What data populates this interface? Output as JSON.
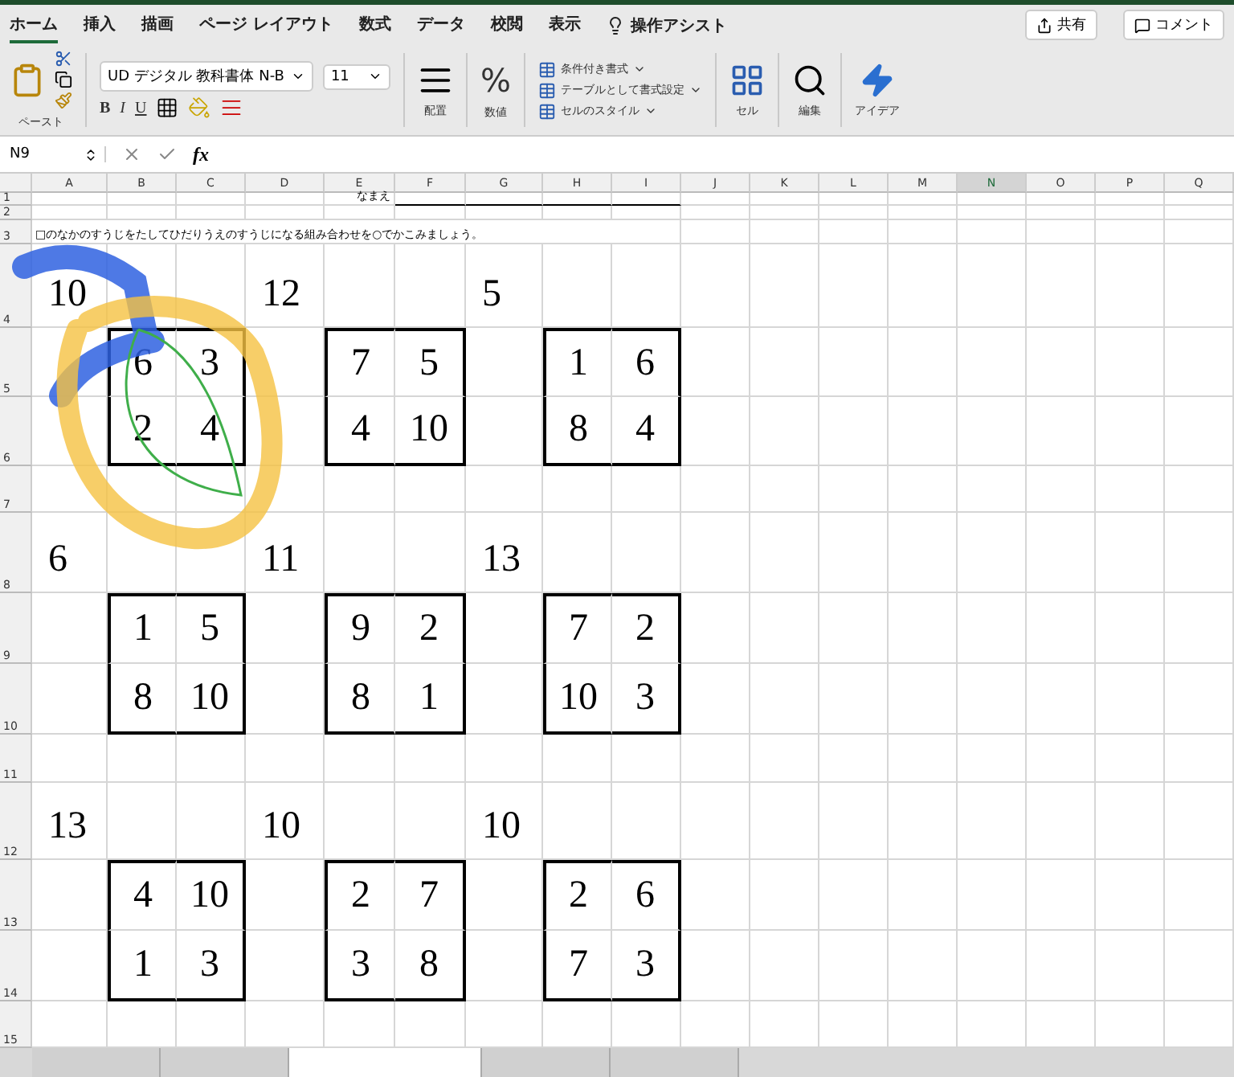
{
  "menu_tabs": [
    {
      "label": "ホーム",
      "selected": true
    },
    {
      "label": "挿入",
      "selected": false
    },
    {
      "label": "描画",
      "selected": false
    },
    {
      "label": "ページ レイアウト",
      "selected": false
    },
    {
      "label": "数式",
      "selected": false
    },
    {
      "label": "データ",
      "selected": false
    },
    {
      "label": "校閲",
      "selected": false
    },
    {
      "label": "表示",
      "selected": false
    }
  ],
  "tell_me": "操作アシスト",
  "share_button": "共有",
  "comment_button": "コメント",
  "ribbon": {
    "paste": "ペースト",
    "font_name": "UD デジタル 教科書体 N-B",
    "font_size": "11",
    "bold": "B",
    "italic": "I",
    "underline": "U",
    "alignment": "配置",
    "percent": "%",
    "number": "数値",
    "styles": [
      "条件付き書式",
      "テーブルとして書式設定",
      "セルのスタイル"
    ],
    "cells": "セル",
    "editing": "編集",
    "ideas": "アイデア"
  },
  "formula_bar": {
    "name_box": "N9",
    "fx": "fx"
  },
  "columns": [
    {
      "label": "A",
      "selected": false
    },
    {
      "label": "B",
      "selected": false
    },
    {
      "label": "C",
      "selected": false
    },
    {
      "label": "D",
      "selected": false
    },
    {
      "label": "E",
      "selected": false
    },
    {
      "label": "F",
      "selected": false
    },
    {
      "label": "G",
      "selected": false
    },
    {
      "label": "H",
      "selected": false
    },
    {
      "label": "I",
      "selected": false
    },
    {
      "label": "J",
      "selected": false
    },
    {
      "label": "K",
      "selected": false
    },
    {
      "label": "L",
      "selected": false
    },
    {
      "label": "M",
      "selected": false
    },
    {
      "label": "N",
      "selected": true
    },
    {
      "label": "O",
      "selected": false
    },
    {
      "label": "P",
      "selected": false
    },
    {
      "label": "Q",
      "selected": false
    }
  ],
  "rows": [
    "1",
    "2",
    "3",
    "4",
    "5",
    "6",
    "7",
    "8",
    "9",
    "10",
    "11",
    "12",
    "13",
    "14",
    "15"
  ],
  "sheet": {
    "name_label": "なまえ",
    "instruction": "□のなかのすうじをたしてひだりうえのすうじになる組み合わせを○でかこみましょう。",
    "problems": [
      [
        {
          "target": "10",
          "numbers": [
            [
              "6",
              "3"
            ],
            [
              "2",
              "4"
            ]
          ]
        },
        {
          "target": "12",
          "numbers": [
            [
              "7",
              "5"
            ],
            [
              "4",
              "10"
            ]
          ]
        },
        {
          "target": "5",
          "numbers": [
            [
              "1",
              "6"
            ],
            [
              "8",
              "4"
            ]
          ]
        }
      ],
      [
        {
          "target": "6",
          "numbers": [
            [
              "1",
              "5"
            ],
            [
              "8",
              "10"
            ]
          ]
        },
        {
          "target": "11",
          "numbers": [
            [
              "9",
              "2"
            ],
            [
              "8",
              "1"
            ]
          ]
        },
        {
          "target": "13",
          "numbers": [
            [
              "7",
              "2"
            ],
            [
              "10",
              "3"
            ]
          ]
        }
      ],
      [
        {
          "target": "13",
          "numbers": [
            [
              "4",
              "10"
            ],
            [
              "1",
              "3"
            ]
          ]
        },
        {
          "target": "10",
          "numbers": [
            [
              "2",
              "7"
            ],
            [
              "3",
              "8"
            ]
          ]
        },
        {
          "target": "10",
          "numbers": [
            [
              "2",
              "6"
            ],
            [
              "7",
              "3"
            ]
          ]
        }
      ]
    ]
  },
  "sheet_tabs": [
    {
      "selected": false
    },
    {
      "selected": false
    },
    {
      "selected": true
    },
    {
      "selected": false
    },
    {
      "selected": false
    }
  ]
}
